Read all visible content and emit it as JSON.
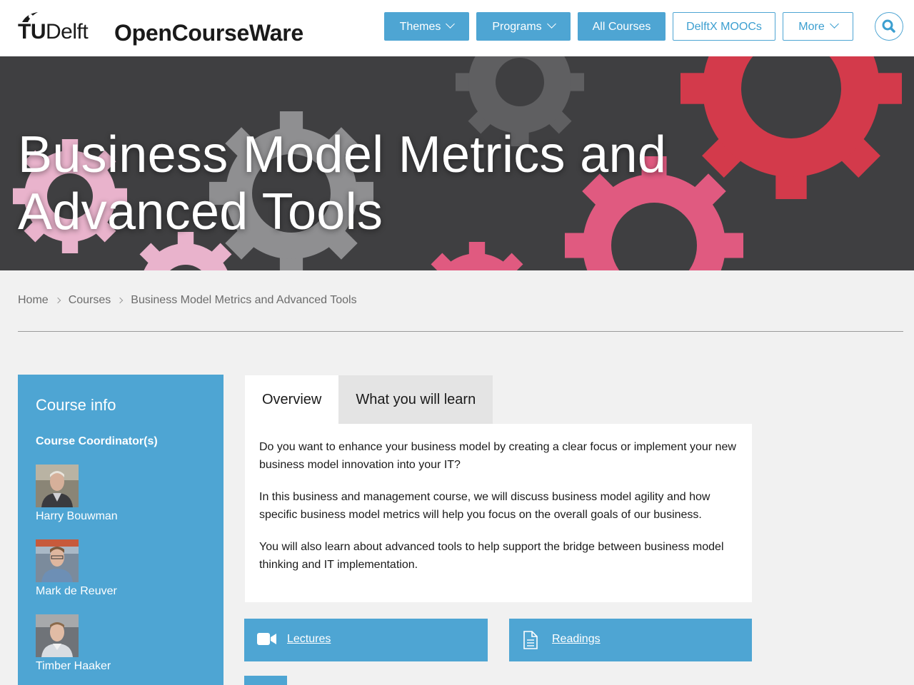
{
  "header": {
    "logo_text_bold": "TU",
    "logo_text": "Delft",
    "site_name": "OpenCourseWare",
    "nav": [
      {
        "label": "Themes"
      },
      {
        "label": "Programs"
      },
      {
        "label": "All Courses"
      },
      {
        "label": "DelftX MOOCs"
      },
      {
        "label": "More"
      }
    ]
  },
  "hero": {
    "title": "Business Model Metrics and Advanced Tools"
  },
  "breadcrumb": [
    "Home",
    "Courses",
    "Business Model Metrics and Advanced Tools"
  ],
  "sidebar": {
    "title": "Course info",
    "coordinators_label": "Course Coordinator(s)",
    "coordinators": [
      {
        "name": "Harry Bouwman"
      },
      {
        "name": "Mark de Reuver"
      },
      {
        "name": "Timber Haaker"
      }
    ]
  },
  "tabs": [
    {
      "label": "Overview"
    },
    {
      "label": "What you will learn"
    }
  ],
  "overview": [
    "Do you want to enhance your business model by creating a clear focus or implement your new business model innovation into your IT?",
    "In this business and management course, we will discuss business model agility and how specific business model metrics will help you focus on the overall goals of our business.",
    "You will also learn about advanced tools to help support the bridge between business model thinking and IT implementation."
  ],
  "resources": [
    {
      "label": "Lectures",
      "icon": "video-camera-icon"
    },
    {
      "label": "Readings",
      "icon": "document-icon"
    }
  ],
  "colors": {
    "accent": "#4ea5d3",
    "hero_bg": "#3f3f41",
    "gear_red": "#d33a4b",
    "gear_pink": "#e05a80",
    "gear_light_pink": "#e9b3cc",
    "gear_grey": "#8f8f91"
  }
}
